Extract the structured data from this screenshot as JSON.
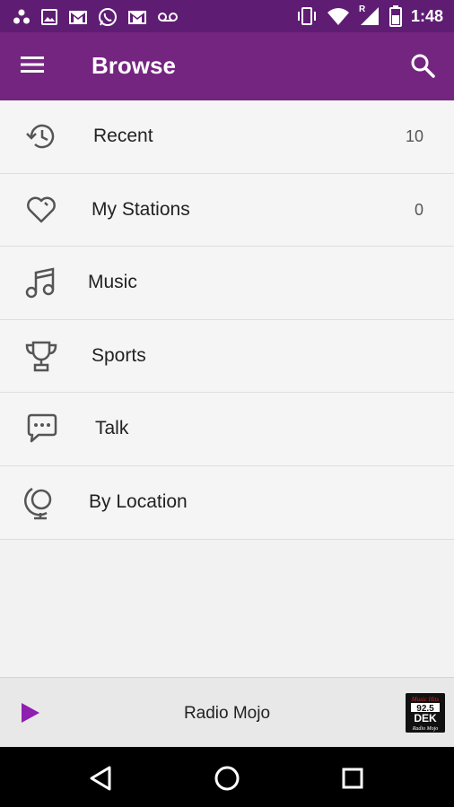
{
  "status_bar": {
    "time": "1:48",
    "left_icons": [
      "dots-icon",
      "image-icon",
      "gmail-icon",
      "whatsapp-icon",
      "mail-icon",
      "voicemail-icon"
    ],
    "right_icons": [
      "vibrate-icon",
      "wifi-icon",
      "signal-icon",
      "battery-icon"
    ],
    "roaming_label": "R"
  },
  "app_bar": {
    "title": "Browse",
    "menu_icon": "menu-icon",
    "search_icon": "search-icon"
  },
  "list": {
    "items": [
      {
        "label": "Recent",
        "count": "10",
        "icon": "history-icon"
      },
      {
        "label": "My Stations",
        "count": "0",
        "icon": "heart-icon"
      },
      {
        "label": "Music",
        "count": "",
        "icon": "music-note-icon"
      },
      {
        "label": "Sports",
        "count": "",
        "icon": "trophy-icon"
      },
      {
        "label": "Talk",
        "count": "",
        "icon": "chat-bubble-icon"
      },
      {
        "label": "By Location",
        "count": "",
        "icon": "globe-icon"
      }
    ]
  },
  "player": {
    "station_name": "Radio Mojo",
    "play_icon": "play-icon",
    "logo": {
      "line1": "Music Hits",
      "line2": "92.5",
      "line3": "DEK",
      "line4": "Radio Mojo"
    }
  },
  "nav_bar": {
    "icons": [
      "back-icon",
      "home-icon",
      "recents-icon"
    ]
  },
  "colors": {
    "status_bar": "#5e1d73",
    "app_bar": "#742580",
    "accent": "#8e1fb1",
    "background": "#f5f5f5"
  }
}
